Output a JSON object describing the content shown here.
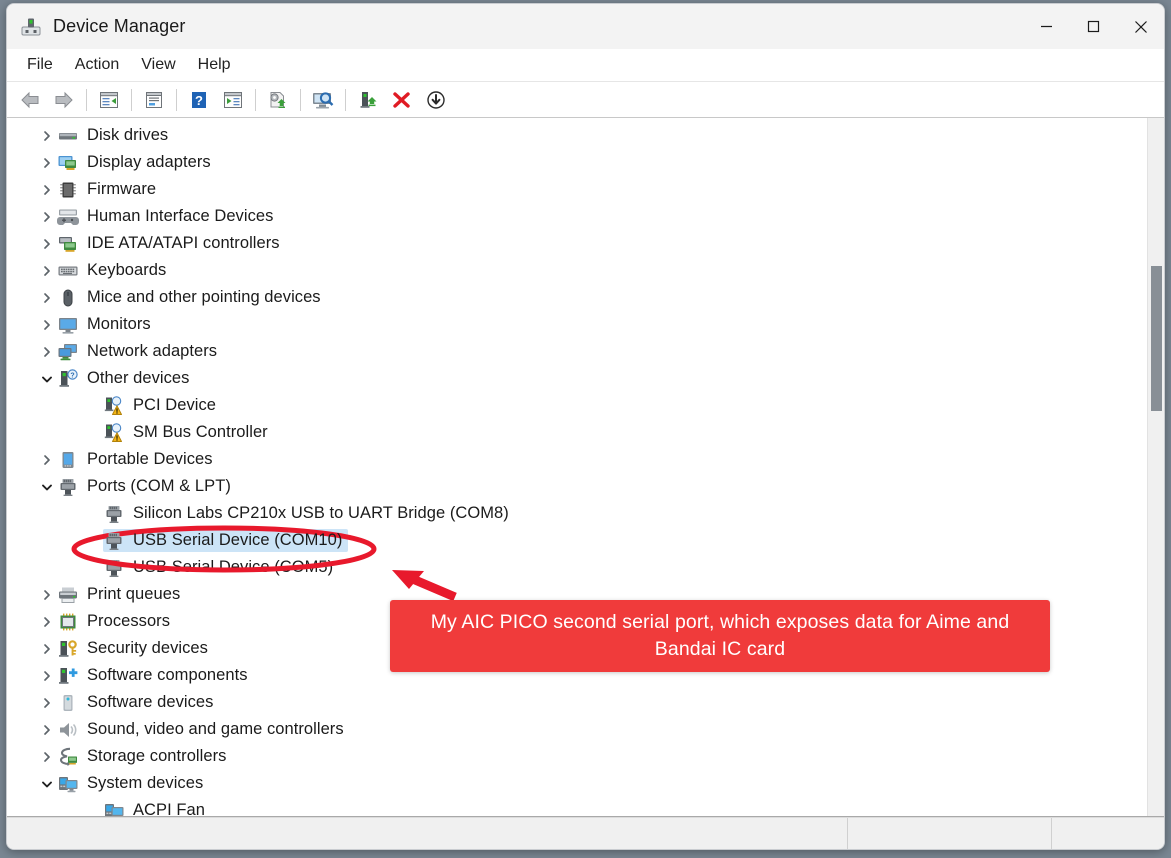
{
  "window": {
    "title": "Device Manager",
    "icon": "device-manager-icon",
    "controls": {
      "minimize": "—",
      "maximize": "□",
      "close": "✕"
    }
  },
  "menubar": {
    "items": [
      {
        "label": "File"
      },
      {
        "label": "Action"
      },
      {
        "label": "View"
      },
      {
        "label": "Help"
      }
    ]
  },
  "toolbar": {
    "buttons": [
      {
        "name": "back-arrow-icon",
        "title": "Back"
      },
      {
        "name": "forward-arrow-icon",
        "title": "Forward"
      },
      {
        "sep": true
      },
      {
        "name": "show-hide-console-tree-icon",
        "title": "Show/Hide Console Tree"
      },
      {
        "sep": true
      },
      {
        "name": "properties-icon",
        "title": "Properties"
      },
      {
        "sep": true
      },
      {
        "name": "help-icon",
        "title": "Help"
      },
      {
        "name": "show-hide-action-pane-icon",
        "title": "Show/Hide Action Pane"
      },
      {
        "sep": true
      },
      {
        "name": "update-driver-icon",
        "title": "Update Driver Software"
      },
      {
        "sep": true
      },
      {
        "name": "scan-hardware-changes-icon",
        "title": "Scan for hardware changes"
      },
      {
        "sep": true
      },
      {
        "name": "enable-device-icon",
        "title": "Enable device"
      },
      {
        "name": "uninstall-device-icon",
        "title": "Uninstall device"
      },
      {
        "name": "disable-device-icon",
        "title": "Disable device"
      }
    ]
  },
  "tree": {
    "rows": [
      {
        "label": "Disk drives",
        "level": 1,
        "expander": "collapsed",
        "icon": "disk-drive-icon"
      },
      {
        "label": "Display adapters",
        "level": 1,
        "expander": "collapsed",
        "icon": "display-adapter-icon"
      },
      {
        "label": "Firmware",
        "level": 1,
        "expander": "collapsed",
        "icon": "firmware-icon"
      },
      {
        "label": "Human Interface Devices",
        "level": 1,
        "expander": "collapsed",
        "icon": "hid-icon"
      },
      {
        "label": "IDE ATA/ATAPI controllers",
        "level": 1,
        "expander": "collapsed",
        "icon": "ide-controller-icon"
      },
      {
        "label": "Keyboards",
        "level": 1,
        "expander": "collapsed",
        "icon": "keyboard-icon"
      },
      {
        "label": "Mice and other pointing devices",
        "level": 1,
        "expander": "collapsed",
        "icon": "mouse-icon"
      },
      {
        "label": "Monitors",
        "level": 1,
        "expander": "collapsed",
        "icon": "monitor-icon"
      },
      {
        "label": "Network adapters",
        "level": 1,
        "expander": "collapsed",
        "icon": "network-adapter-icon"
      },
      {
        "label": "Other devices",
        "level": 1,
        "expander": "expanded",
        "icon": "unknown-device-icon"
      },
      {
        "label": "PCI Device",
        "level": 2,
        "expander": "none",
        "icon": "unknown-device-warning-icon"
      },
      {
        "label": "SM Bus Controller",
        "level": 2,
        "expander": "none",
        "icon": "unknown-device-warning-icon"
      },
      {
        "label": "Portable Devices",
        "level": 1,
        "expander": "collapsed",
        "icon": "portable-device-icon"
      },
      {
        "label": "Ports (COM & LPT)",
        "level": 1,
        "expander": "expanded",
        "icon": "port-icon"
      },
      {
        "label": "Silicon Labs CP210x USB to UART Bridge (COM8)",
        "level": 2,
        "expander": "none",
        "icon": "port-icon"
      },
      {
        "label": "USB Serial Device (COM10)",
        "level": 2,
        "expander": "none",
        "icon": "port-icon",
        "selected": true
      },
      {
        "label": "USB Serial Device (COM5)",
        "level": 2,
        "expander": "none",
        "icon": "port-icon"
      },
      {
        "label": "Print queues",
        "level": 1,
        "expander": "collapsed",
        "icon": "printer-icon"
      },
      {
        "label": "Processors",
        "level": 1,
        "expander": "collapsed",
        "icon": "processor-icon"
      },
      {
        "label": "Security devices",
        "level": 1,
        "expander": "collapsed",
        "icon": "security-device-icon"
      },
      {
        "label": "Software components",
        "level": 1,
        "expander": "collapsed",
        "icon": "software-component-icon"
      },
      {
        "label": "Software devices",
        "level": 1,
        "expander": "collapsed",
        "icon": "software-device-icon"
      },
      {
        "label": "Sound, video and game controllers",
        "level": 1,
        "expander": "collapsed",
        "icon": "sound-device-icon"
      },
      {
        "label": "Storage controllers",
        "level": 1,
        "expander": "collapsed",
        "icon": "storage-controller-icon"
      },
      {
        "label": "System devices",
        "level": 1,
        "expander": "expanded",
        "icon": "system-device-icon"
      },
      {
        "label": "ACPI Fan",
        "level": 2,
        "expander": "none",
        "icon": "system-device-icon"
      }
    ]
  },
  "annotation": {
    "callout_text": "My AIC PICO second serial port, which exposes data for Aime and Bandai IC card",
    "highlight_color": "#f03b3b",
    "selection_color": "#cce4f7",
    "ellipse_target": "USB Serial Device (COM10)"
  },
  "statusbar": {
    "main": "",
    "segment_b": "",
    "segment_c": ""
  }
}
